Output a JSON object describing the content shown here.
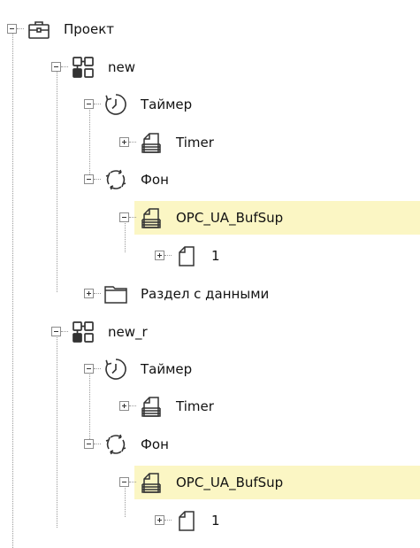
{
  "tree": {
    "nodes": [
      {
        "label": "Проект",
        "icon": "project-briefcase-icon",
        "state": "expanded",
        "depth": 0
      },
      {
        "label": "new",
        "icon": "program-blocks-icon",
        "state": "expanded",
        "depth": 1
      },
      {
        "label": "Таймер",
        "icon": "clock-timer-icon",
        "state": "expanded",
        "depth": 2
      },
      {
        "label": "Timer",
        "icon": "task-page-icon",
        "state": "collapsed",
        "depth": 3
      },
      {
        "label": "Фон",
        "icon": "cycle-arrows-icon",
        "state": "expanded",
        "depth": 2
      },
      {
        "label": "OPC_UA_BufSup",
        "icon": "task-page-icon",
        "state": "expanded",
        "depth": 3,
        "selected": true
      },
      {
        "label": "1",
        "icon": "document-page-icon",
        "state": "collapsed",
        "depth": 4
      },
      {
        "label": "Раздел с данными",
        "icon": "folder-icon",
        "state": "collapsed",
        "depth": 2
      },
      {
        "label": "new_r",
        "icon": "program-blocks-icon",
        "state": "expanded",
        "depth": 1
      },
      {
        "label": "Таймер",
        "icon": "clock-timer-icon",
        "state": "expanded",
        "depth": 2
      },
      {
        "label": "Timer",
        "icon": "task-page-icon",
        "state": "collapsed",
        "depth": 3
      },
      {
        "label": "Фон",
        "icon": "cycle-arrows-icon",
        "state": "expanded",
        "depth": 2
      },
      {
        "label": "OPC_UA_BufSup",
        "icon": "task-page-icon",
        "state": "expanded",
        "depth": 3,
        "selected": true
      },
      {
        "label": "1",
        "icon": "document-page-icon",
        "state": "collapsed",
        "depth": 4
      }
    ]
  },
  "colors": {
    "selection_background": "#fbf6c4",
    "connector_line": "#9a9a9a",
    "icon_stroke": "#333333"
  }
}
